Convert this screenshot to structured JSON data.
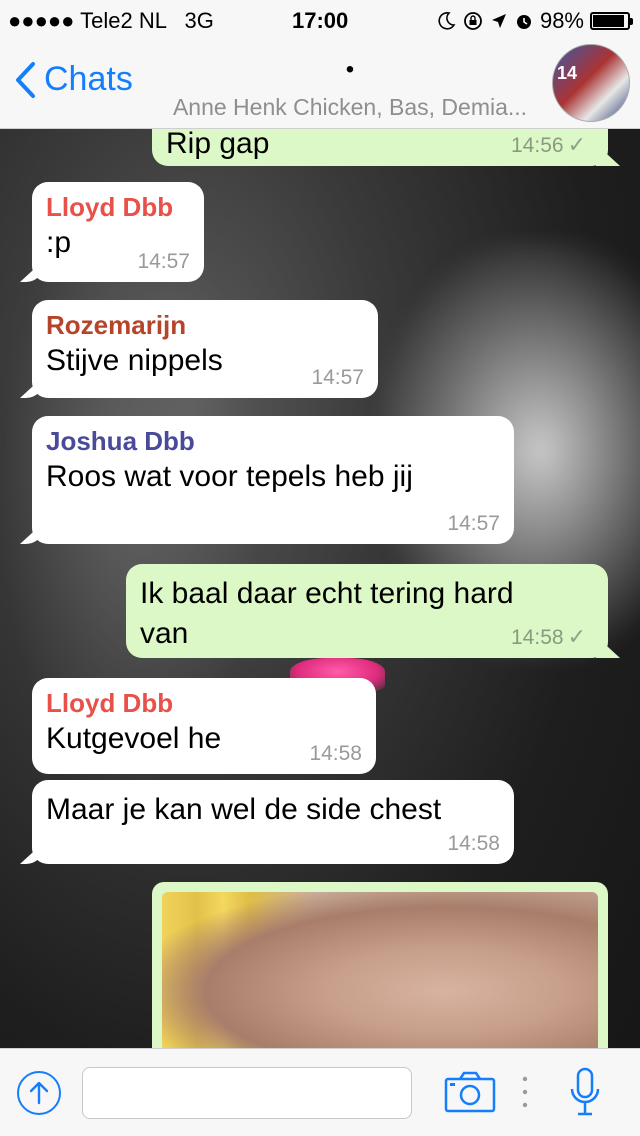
{
  "status_bar": {
    "carrier": "●●●●● Tele2 NL",
    "network": "3G",
    "time": "17:00",
    "battery": "98%",
    "battery_level": 0.98
  },
  "nav": {
    "back_label": "Chats",
    "title_dot": "•",
    "members": "Anne Henk Chicken, Bas, Demia...",
    "avatar_badge": "14"
  },
  "colors": {
    "accent": "#157efb",
    "incoming_bubble": "#ffffff",
    "outgoing_bubble": "#dcf8c6"
  },
  "messages": [
    {
      "direction": "out",
      "text": "Rip gap",
      "time": "14:56"
    },
    {
      "direction": "in",
      "sender": "Lloyd Dbb",
      "sender_color": "#e8514a",
      "text": ":p",
      "time": "14:57"
    },
    {
      "direction": "in",
      "sender": "Rozemarijn",
      "sender_color": "#b5442a",
      "text": "Stijve nippels",
      "time": "14:57"
    },
    {
      "direction": "in",
      "sender": "Joshua Dbb",
      "sender_color": "#4a4a9a",
      "text": "Roos wat voor tepels heb jij",
      "time": "14:57"
    },
    {
      "direction": "out",
      "text_line1": "Ik baal daar echt tering hard",
      "text_line2": "van",
      "time": "14:58"
    },
    {
      "direction": "in",
      "sender": "Lloyd Dbb",
      "sender_color": "#e8514a",
      "text": "Kutgevoel he",
      "time": "14:58"
    },
    {
      "direction": "in",
      "text": "Maar je kan wel de side chest",
      "time": "14:58"
    }
  ],
  "input": {
    "placeholder": ""
  }
}
